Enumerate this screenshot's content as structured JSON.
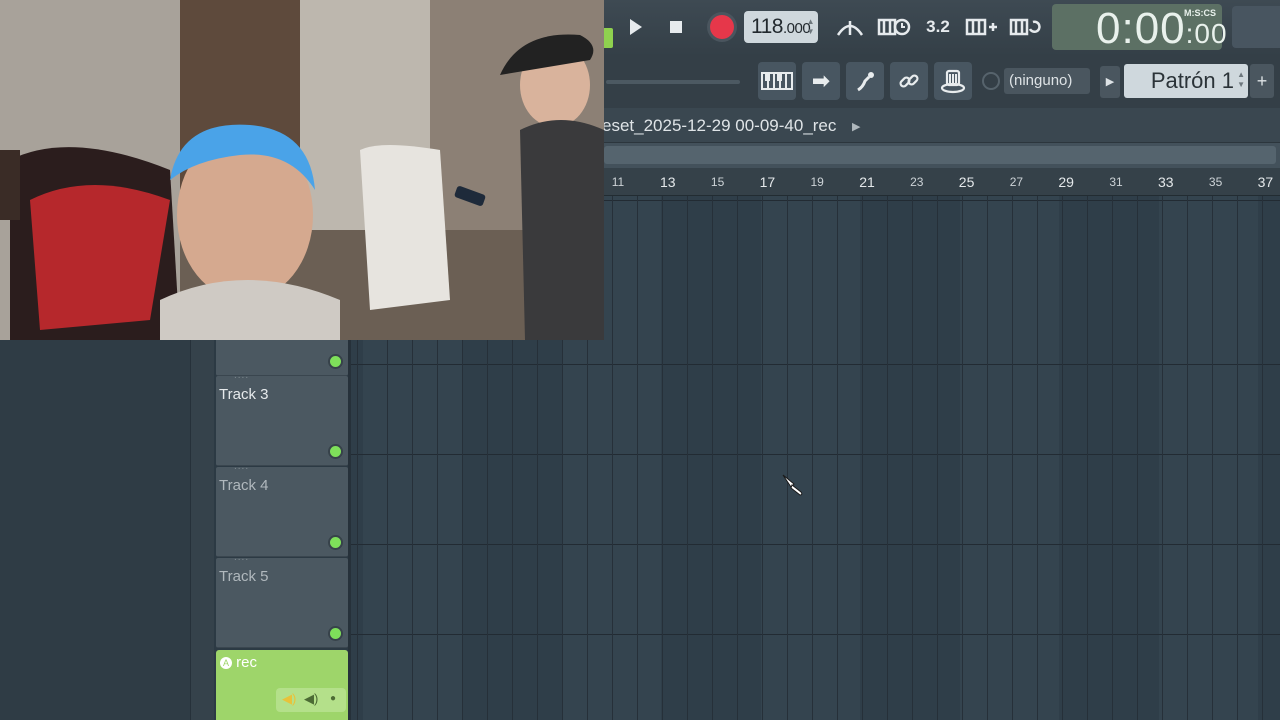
{
  "toolbar": {
    "tempo": "118",
    "tempo_decimals": ".000",
    "time_main": "0:00",
    "time_cs": ":00",
    "time_format": "M:S:CS",
    "metronome_glyph": "3.2",
    "pattern_select": "(ninguno)",
    "pattern_name": "Patrón 1",
    "add_label": "+"
  },
  "playlist": {
    "title": "eset_2025-12-29 00-09-40_rec",
    "ruler": [
      "11",
      "13",
      "15",
      "17",
      "19",
      "21",
      "23",
      "25",
      "27",
      "29",
      "31",
      "33",
      "35",
      "37"
    ]
  },
  "tracks": [
    {
      "name": "Track 3"
    },
    {
      "name": "Track 4"
    },
    {
      "name": "Track 5"
    }
  ],
  "rec_track": {
    "name": "rec"
  },
  "colors": {
    "accent_green": "#9ed56a",
    "led_green": "#7ee05a",
    "record_red": "#e6374a"
  },
  "icons": [
    "play-icon",
    "stop-icon",
    "record-icon",
    "metronome-icon",
    "piano-icon",
    "arrow-right-icon",
    "link-icon",
    "hat-icon",
    "paint-brush-cursor-icon"
  ]
}
